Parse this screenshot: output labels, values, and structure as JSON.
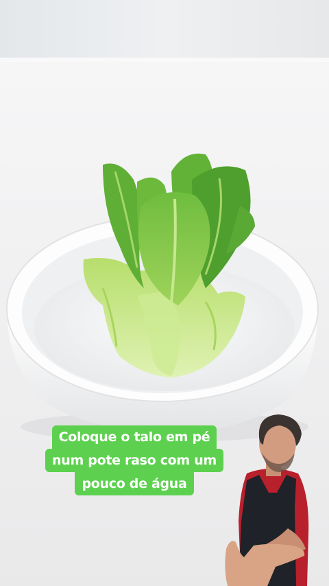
{
  "video": {
    "caption_lines": [
      "Coloque o talo em pé",
      "num pote raso com um",
      "pouco de água"
    ]
  },
  "colors": {
    "caption_bg": "#5dd14f",
    "caption_text": "#ffffff",
    "background": "#f2f2f3",
    "bowl": "#fafafa",
    "lettuce_light": "#c9e88a",
    "lettuce_dark": "#4f9a2e"
  },
  "scene": {
    "subject": "lettuce-stalk-in-bowl",
    "presenter": "man-in-apron"
  }
}
